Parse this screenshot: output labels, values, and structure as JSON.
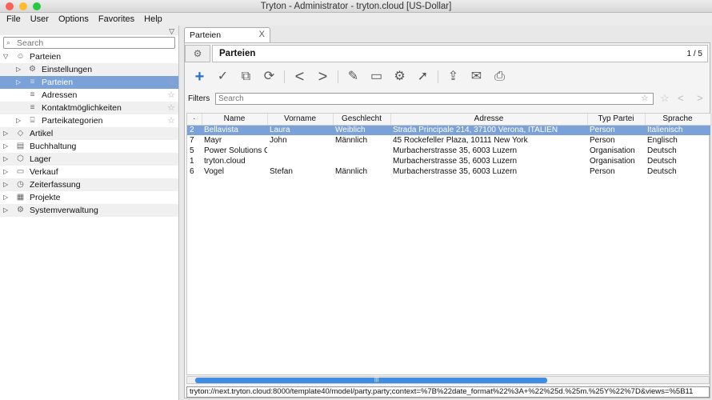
{
  "window": {
    "title": "Tryton - Administrator - tryton.cloud [US-Dollar]"
  },
  "menu": [
    "File",
    "User",
    "Options",
    "Favorites",
    "Help"
  ],
  "sidebar": {
    "search_placeholder": "Search",
    "items": [
      {
        "label": "Parteien",
        "icon": "person-icon"
      },
      {
        "label": "Einstellungen",
        "icon": "gear-icon"
      },
      {
        "label": "Parteien",
        "icon": "list-icon"
      },
      {
        "label": "Adressen",
        "icon": "list-icon"
      },
      {
        "label": "Kontaktmöglichkeiten",
        "icon": "list-icon"
      },
      {
        "label": "Parteikategorien",
        "icon": "tree-icon"
      },
      {
        "label": "Artikel",
        "icon": "tag-icon"
      },
      {
        "label": "Buchhaltung",
        "icon": "ledger-icon"
      },
      {
        "label": "Lager",
        "icon": "box-icon"
      },
      {
        "label": "Verkauf",
        "icon": "folder-icon"
      },
      {
        "label": "Zeiterfassung",
        "icon": "clock-icon"
      },
      {
        "label": "Projekte",
        "icon": "project-icon"
      },
      {
        "label": "Systemverwaltung",
        "icon": "gear-icon"
      }
    ]
  },
  "tab": {
    "label": "Parteien",
    "close": "X"
  },
  "form": {
    "title": "Parteien",
    "count": "1 / 5"
  },
  "filters": {
    "label": "Filters",
    "placeholder": "Search"
  },
  "table": {
    "columns": [
      "Name",
      "Vorname",
      "Geschlecht",
      "Adresse",
      "Typ Partei",
      "Sprache"
    ],
    "rows": [
      {
        "id": "2",
        "name": "Bellavista",
        "vorname": "Laura",
        "geschlecht": "Weiblich",
        "adresse": "Strada Principale 214, 37100 Verona, ITALIEN",
        "typ": "Person",
        "sprache": "Italienisch"
      },
      {
        "id": "7",
        "name": "Mayr",
        "vorname": "John",
        "geschlecht": "Männlich",
        "adresse": "45 Rockefeller Plaza, 10111 New York",
        "typ": "Person",
        "sprache": "Englisch"
      },
      {
        "id": "5",
        "name": "Power Solutions G",
        "vorname": "",
        "geschlecht": "",
        "adresse": "Murbacherstrasse 35, 6003 Luzern",
        "typ": "Organisation",
        "sprache": "Deutsch"
      },
      {
        "id": "1",
        "name": "tryton.cloud",
        "vorname": "",
        "geschlecht": "",
        "adresse": "Murbacherstrasse 35, 6003 Luzern",
        "typ": "Organisation",
        "sprache": "Deutsch"
      },
      {
        "id": "6",
        "name": "Vogel",
        "vorname": "Stefan",
        "geschlecht": "Männlich",
        "adresse": "Murbacherstrasse 35, 6003 Luzern",
        "typ": "Person",
        "sprache": "Deutsch"
      }
    ]
  },
  "url": "tryton://next.tryton.cloud:8000/template40/model/party.party;context=%7B%22date_format%22%3A+%22%25d.%25m.%25Y%22%7D&views=%5B11"
}
